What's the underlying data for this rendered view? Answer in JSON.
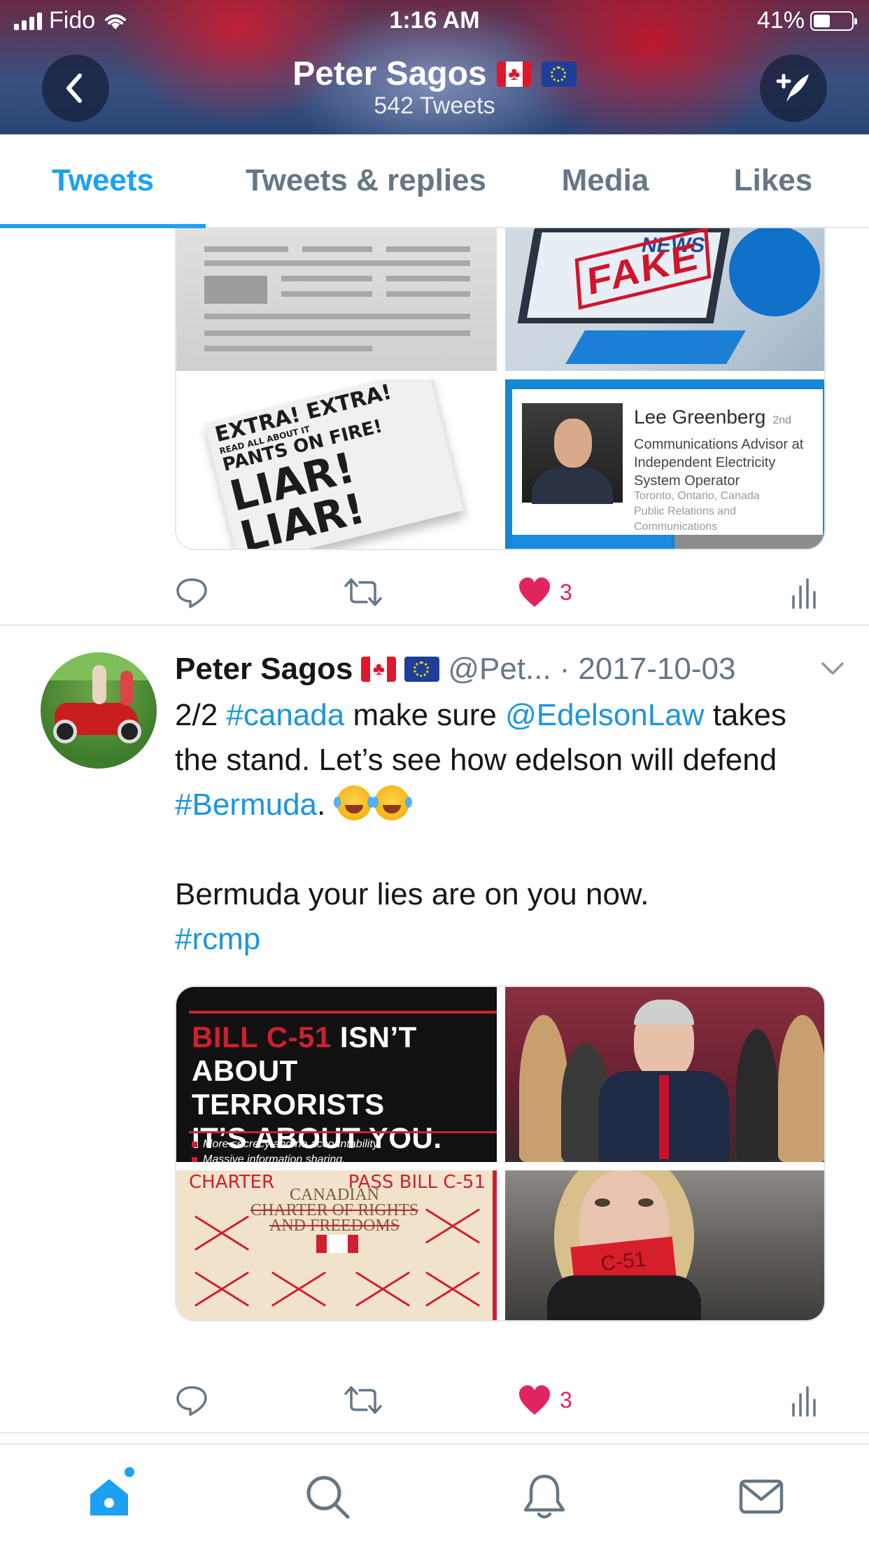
{
  "status_bar": {
    "carrier": "Fido",
    "time": "1:16 AM",
    "battery": "41%"
  },
  "header": {
    "name": "Peter Sagos",
    "flags": [
      "flag-canada",
      "flag-eu"
    ],
    "tweet_count": "542 Tweets"
  },
  "tabs": [
    "Tweets",
    "Tweets & replies",
    "Media",
    "Likes"
  ],
  "active_tab": "Tweets",
  "tweet1": {
    "linkedin_card": {
      "name": "Lee Greenberg",
      "degree": "2nd",
      "title": "Communications Advisor at Independent Electricity System Operator",
      "location": "Toronto, Ontario, Canada",
      "industry": "Public Relations and Communications"
    },
    "fake_news_text": "NEWS",
    "fake_stamp": "FAKE",
    "liar_lines": [
      "EXTRA! EXTRA!",
      "READ ALL ABOUT IT",
      "PANTS ON FIRE!",
      "LIAR!",
      "LIAR!"
    ],
    "likes": "3"
  },
  "tweet2": {
    "name": "Peter Sagos",
    "handle": "@Pet...",
    "separator": "·",
    "date": "2017-10-03",
    "text": {
      "prefix": "2/2 ",
      "hashtag_canada": "#canada",
      "mid1": " make sure ",
      "mention": "@EdelsonLaw",
      "mid2": " takes the stand. Let’s see how edelson will defend ",
      "hashtag_bermuda": "#Bermuda",
      "mid3": ". ",
      "line2": "Bermuda your lies are on you now.",
      "hashtag_rcmp": "#rcmp"
    },
    "poster": {
      "red": "BILL C-51",
      "line1": " ISN’T",
      "line2": "ABOUT TERRORISTS",
      "line3": "IT’S ABOUT YOU.",
      "bullet1": "More secrecy and no accountability.",
      "bullet2": "Massive information sharing."
    },
    "charter": {
      "left": "CHARTER",
      "right": "PASS BILL C-51",
      "title1": "CANADIAN",
      "title2": "CHARTER OF RIGHTS",
      "title3": "AND FREEDOMS"
    },
    "tape_text": "C-51",
    "likes": "3"
  },
  "colors": {
    "accent": "#1da1f2",
    "like": "#e0245e",
    "muted": "#657786"
  },
  "bottom_nav": [
    "home-icon",
    "search-icon",
    "notifications-icon",
    "messages-icon"
  ]
}
